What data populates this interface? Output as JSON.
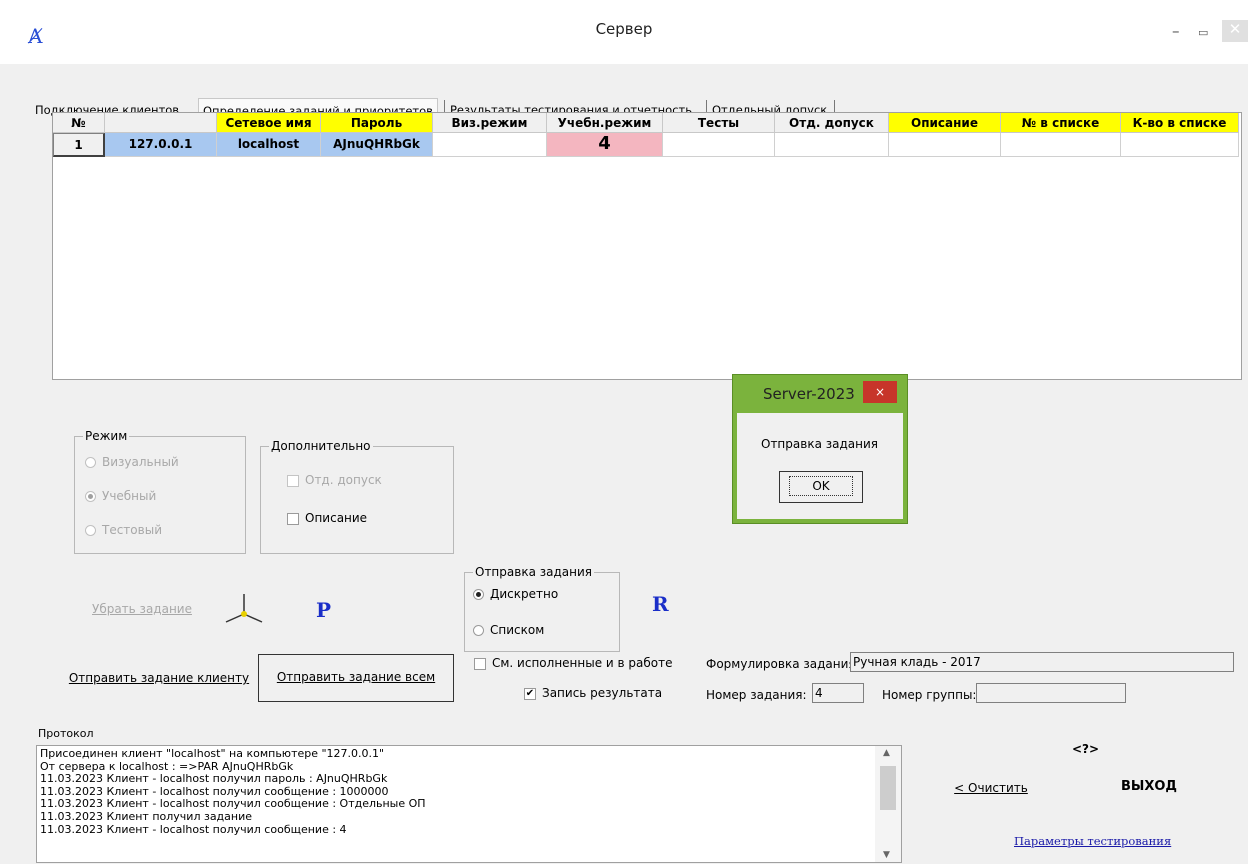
{
  "window": {
    "title": "Сервер",
    "icon": "app-logo-icon"
  },
  "tabs": [
    {
      "label": "Подключение клиентов"
    },
    {
      "label": "Определение заданий и приоритетов"
    },
    {
      "label": "Результаты тестирования и отчетность"
    },
    {
      "label": "Отдельный допуск"
    }
  ],
  "grid": {
    "headers": [
      "№",
      "",
      "Сетевое имя",
      "Пароль",
      "Виз.режим",
      "Учебн.режим",
      "Тесты",
      "Отд. допуск",
      "Описание",
      "№ в списке",
      "К-во в списке"
    ],
    "row": {
      "num": "1",
      "ip": "127.0.0.1",
      "name": "localhost",
      "password": "AJnuQHRbGk",
      "study_mode": "4"
    }
  },
  "mode_group": {
    "title": "Режим",
    "options": [
      {
        "label": "Визуальный",
        "selected": false
      },
      {
        "label": "Учебный",
        "selected": true
      },
      {
        "label": "Тестовый",
        "selected": false
      }
    ]
  },
  "extra_group": {
    "title": "Дополнительно",
    "separate_access": "Отд. допуск",
    "description": "Описание"
  },
  "remove_task": "Убрать задание",
  "icon_p": "P",
  "icon_r": "R",
  "send_group": {
    "title": "Отправка задания",
    "discrete": "Дискретно",
    "list": "Списком"
  },
  "send_client": "Отправить задание клиенту",
  "send_all": "Отправить задание всем",
  "show_done": "См. исполненные и в работе",
  "record_result": "Запись результата",
  "task_wording_label": "Формулировка задания:",
  "task_wording_value": "Ручная кладь - 2017",
  "task_number_label": "Номер задания:",
  "task_number_value": "4",
  "group_number_label": "Номер группы:",
  "group_number_value": "",
  "dialog": {
    "title": "Server-2023",
    "message": "Отправка задания",
    "ok": "OK",
    "close": "×"
  },
  "protocol": {
    "title": "Протокол",
    "lines": [
      "Присоединен клиент \"localhost\" на компьютере \"127.0.0.1\"",
      " От сервера к localhost : =>PAR AJnuQHRbGk",
      "11.03.2023 Клиент - localhost получил пароль : AJnuQHRbGk",
      "11.03.2023 Клиент - localhost получил сообщение : 1000000",
      "11.03.2023 Клиент - localhost получил сообщение : Отдельные ОП",
      "11.03.2023 Клиент  получил задание",
      "11.03.2023 Клиент - localhost получил сообщение : 4"
    ]
  },
  "help": "<?>",
  "clear": "< Очистить",
  "exit": "ВЫХОД",
  "test_params": "Параметры тестирования",
  "colors": {
    "header_yellow": "#ffff00",
    "selection_blue": "#a8c8f0",
    "pink": "#f4b6c0",
    "dialog_green": "#7bb33d"
  }
}
